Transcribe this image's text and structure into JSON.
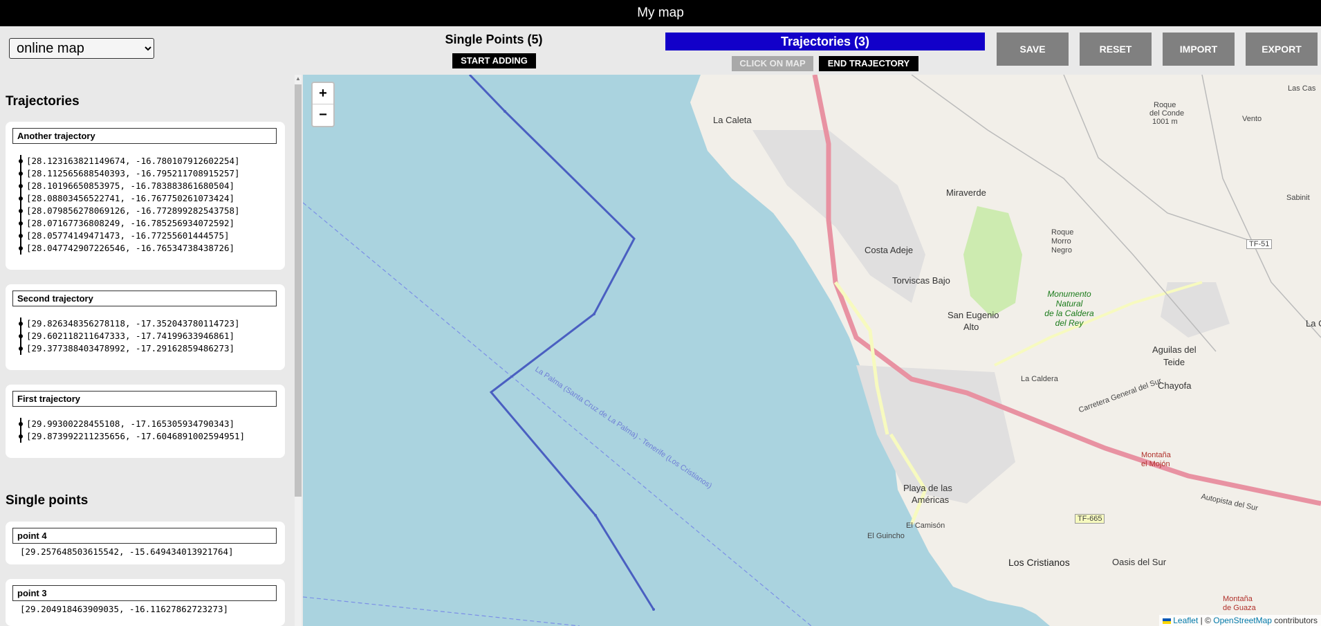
{
  "app": {
    "title": "My map"
  },
  "controls": {
    "map_select_value": "online map",
    "single_points_title": "Single Points (5)",
    "start_adding_label": "START ADDING",
    "trajectories_title": "Trajectories (3)",
    "click_on_map_label": "CLICK ON MAP",
    "end_trajectory_label": "END TRAJECTORY",
    "save_label": "SAVE",
    "reset_label": "RESET",
    "import_label": "IMPORT",
    "export_label": "EXPORT"
  },
  "sidebar": {
    "trajectories_heading": "Trajectories",
    "single_points_heading": "Single points",
    "trajectories": [
      {
        "name": "Another trajectory",
        "coords": [
          "[28.123163821149674, -16.780107912602254]",
          "[28.112565688540393, -16.795211708915257]",
          "[28.10196650853975, -16.783883861680504]",
          "[28.08803456522741, -16.767750261073424]",
          "[28.079856278069126, -16.772899282543758]",
          "[28.07167736808249, -16.785256934072592]",
          "[28.05774149471473, -16.77255601444575]",
          "[28.047742907226546, -16.76534738438726]"
        ]
      },
      {
        "name": "Second trajectory",
        "coords": [
          "[29.826348356278118, -17.352043780114723]",
          "[29.602118211647333, -17.74199633946861]",
          "[29.377388403478992, -17.29162859486273]"
        ]
      },
      {
        "name": "First trajectory",
        "coords": [
          "[29.99300228455108, -17.165305934790343]",
          "[29.873992211235656, -17.6046891002594951]"
        ]
      }
    ],
    "points": [
      {
        "name": "point 4",
        "coord": "[29.257648503615542, -15.649434013921764]"
      },
      {
        "name": "point 3",
        "coord": "[29.204918463909035, -16.11627862723273]"
      }
    ]
  },
  "map": {
    "zoom_in": "+",
    "zoom_out": "−",
    "attribution_leaflet": "Leaflet",
    "attribution_sep": " | © ",
    "attribution_osm": "OpenStreetMap",
    "attribution_tail": " contributors",
    "ferry_label": "La Palma (Santa Cruz de La Palma) - Tenerife (Los Cristianos)",
    "labels": {
      "la_caleta": "La Caleta",
      "miraverde": "Miraverde",
      "costa_adeje": "Costa Adeje",
      "torviscas": "Torviscas Bajo",
      "san_eugenio_1": "San Eugenio",
      "san_eugenio_2": "Alto",
      "roque_morro_1": "Roque",
      "roque_morro_2": "Morro",
      "roque_morro_3": "Negro",
      "monumento_1": "Monumento",
      "monumento_2": "Natural",
      "monumento_3": "de la Caldera",
      "monumento_4": "del Rey",
      "la_caldera": "La Caldera",
      "aguilas_1": "Aguilas del",
      "aguilas_2": "Teide",
      "chayofa": "Chayofa",
      "montana_mojon_1": "Montaña",
      "montana_mojon_2": "el Mojón",
      "playa_americas_1": "Playa de las",
      "playa_americas_2": "Américas",
      "el_camison": "El Camisón",
      "el_guincho": "El Guincho",
      "los_cristianos": "Los Cristianos",
      "oasis": "Oasis del Sur",
      "montana_guaza_1": "Montaña",
      "montana_guaza_2": "de Guaza",
      "roque_conde_1": "Roque",
      "roque_conde_2": "del Conde",
      "roque_conde_3": "1001 m",
      "vento": "Vento",
      "las_cas": "Las Cas",
      "sabinit": "Sabinit",
      "la_c": "La C",
      "tf51": "TF-51",
      "tf665": "TF-665",
      "autopista": "Autopista del Sur",
      "carretera": "Carretera General del Sur"
    }
  }
}
